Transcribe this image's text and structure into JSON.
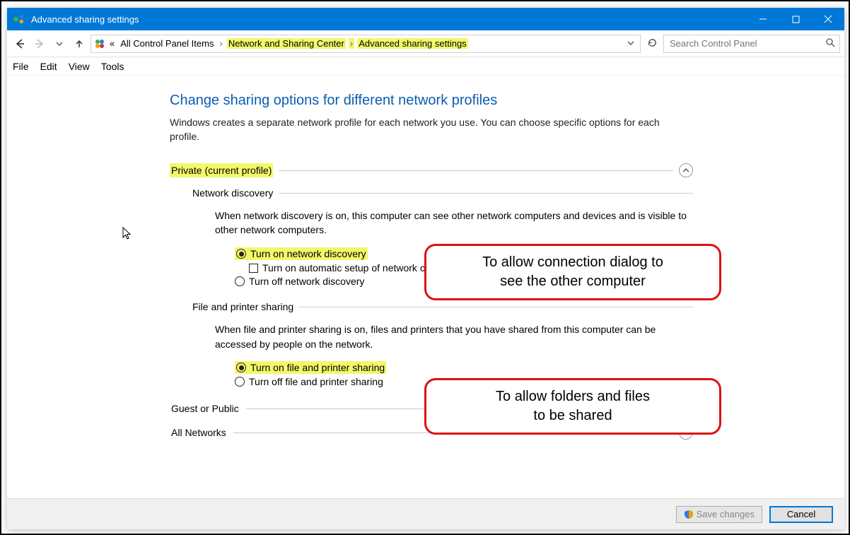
{
  "window": {
    "title": "Advanced sharing settings"
  },
  "nav": {
    "crumb_prefix": "«",
    "crumb1": "All Control Panel Items",
    "crumb2": "Network and Sharing Center",
    "crumb3": "Advanced sharing settings",
    "search_placeholder": "Search Control Panel"
  },
  "menu": {
    "file": "File",
    "edit": "Edit",
    "view": "View",
    "tools": "Tools"
  },
  "main": {
    "heading": "Change sharing options for different network profiles",
    "sub": "Windows creates a separate network profile for each network you use. You can choose specific options for each profile.",
    "private_label": "Private (current profile)",
    "guest_label": "Guest or Public",
    "all_label": "All Networks",
    "nd": {
      "title": "Network discovery",
      "desc": "When network discovery is on, this computer can see other network computers and devices and is visible to other network computers.",
      "on": "Turn on network discovery",
      "auto": "Turn on automatic setup of network connected devices.",
      "off": "Turn off network discovery"
    },
    "fp": {
      "title": "File and printer sharing",
      "desc": "When file and printer sharing is on, files and printers that you have shared from this computer can be accessed by people on the network.",
      "on": "Turn on file and printer sharing",
      "off": "Turn off file and printer sharing"
    }
  },
  "annotations": {
    "a1_l1": "To allow connection dialog to",
    "a1_l2": "see the other computer",
    "a2_l1": "To allow folders and files",
    "a2_l2": "to be shared"
  },
  "footer": {
    "save": "Save changes",
    "cancel": "Cancel"
  }
}
